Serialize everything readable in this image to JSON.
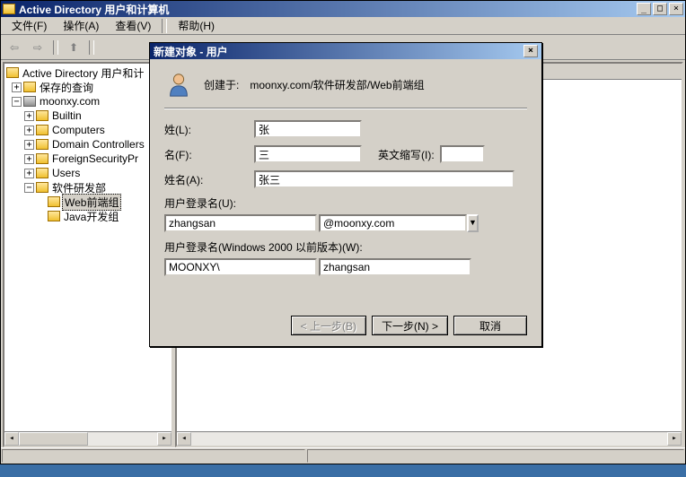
{
  "window": {
    "title": "Active Directory 用户和计算机",
    "menus": {
      "file": "文件(F)",
      "action": "操作(A)",
      "view": "查看(V)",
      "help": "帮助(H)"
    },
    "win_controls": {
      "min": "_",
      "max": "□",
      "close": "×"
    }
  },
  "tree": {
    "root": "Active Directory 用户和计",
    "saved_queries": "保存的查询",
    "domain": "moonxy.com",
    "builtin": "Builtin",
    "computers": "Computers",
    "domain_controllers": "Domain Controllers",
    "fsp": "ForeignSecurityPr",
    "users": "Users",
    "dev_dept": "软件研发部",
    "web_team": "Web前端组",
    "java_team": "Java开发组"
  },
  "dialog": {
    "title": "新建对象 - 用户",
    "create_in_label": "创建于:",
    "create_in_path": "moonxy.com/软件研发部/Web前端组",
    "labels": {
      "surname": "姓(L):",
      "given": "名(F):",
      "initials": "英文缩写(I):",
      "fullname": "姓名(A):",
      "login": "用户登录名(U):",
      "login_pre2k": "用户登录名(Windows 2000 以前版本)(W):"
    },
    "values": {
      "surname": "张",
      "given": "三",
      "initials": "",
      "fullname": "张三",
      "login": "zhangsan",
      "domain_suffix": "@moonxy.com",
      "pre2k_domain": "MOONXY\\",
      "pre2k_login": "zhangsan"
    },
    "buttons": {
      "back": "< 上一步(B)",
      "next": "下一步(N) >",
      "cancel": "取消"
    },
    "close": "×"
  }
}
